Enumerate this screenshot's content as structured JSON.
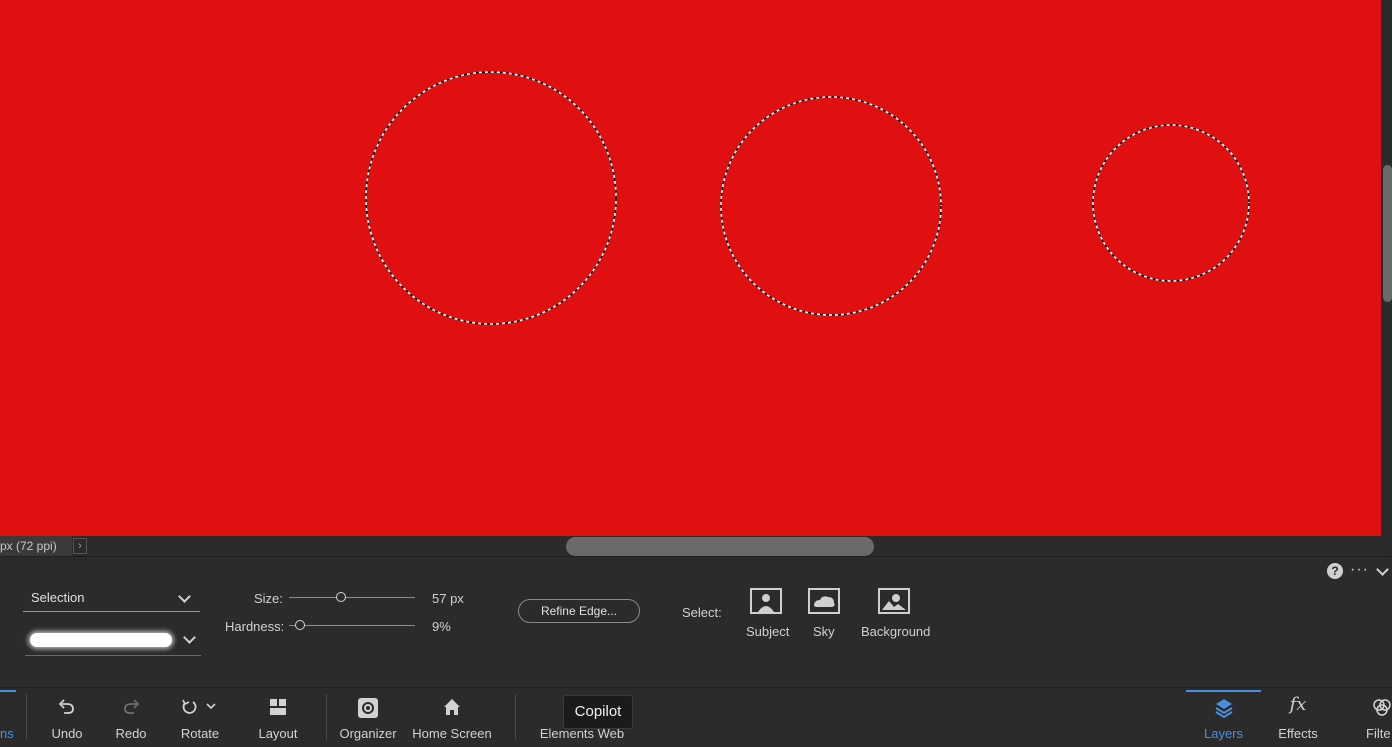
{
  "canvas": {
    "background": "#e00f10"
  },
  "status_bar": {
    "doc_info": "px (72 ppi)",
    "arrow": "›"
  },
  "tool_options": {
    "mode_dropdown": "Selection",
    "size": {
      "label": "Size:",
      "value": "57 px",
      "level": 0.41
    },
    "hardness": {
      "label": "Hardness:",
      "value": "9%",
      "level": 0.09
    },
    "refine_edge": "Refine Edge...",
    "select_label": "Select:",
    "select_buttons": [
      "Subject",
      "Sky",
      "Background"
    ],
    "help_icon": "?",
    "more_icon": "···"
  },
  "taskbar": {
    "left_tab_fragment": "ns",
    "items": [
      "Undo",
      "Redo",
      "Rotate",
      "Layout",
      "Organizer",
      "Home Screen",
      "Elements Web"
    ],
    "tooltip": "Copilot",
    "panels": [
      "Layers",
      "Effects",
      "Filte"
    ],
    "accent": "#4b8dde"
  }
}
